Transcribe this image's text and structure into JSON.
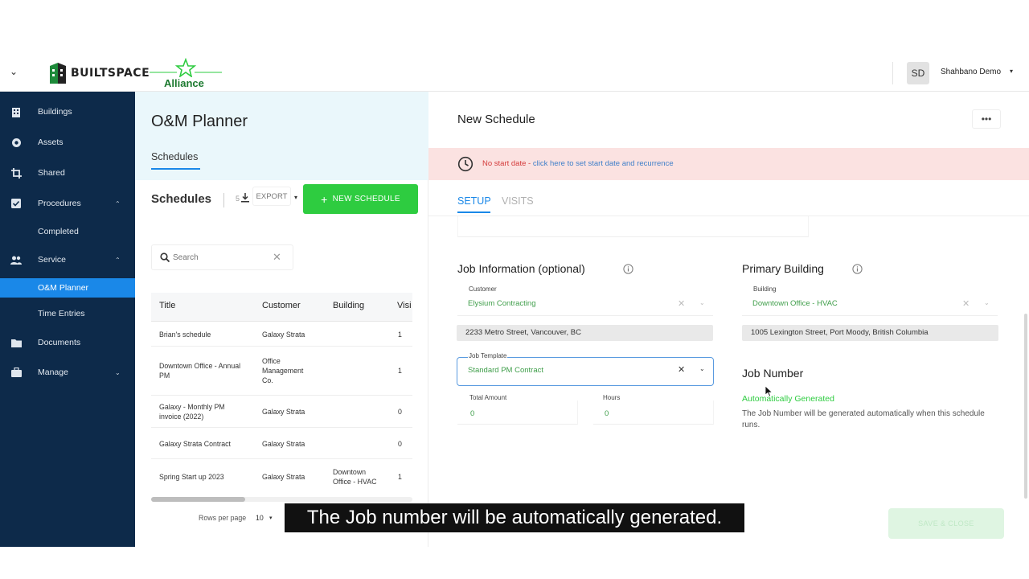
{
  "header": {
    "brand_name": "BUILTSPACE",
    "partner_name": "Alliance",
    "user_initials": "SD",
    "user_name": "Shahbano Demo",
    "user_caret": "▾",
    "menu_chevron": "⌄"
  },
  "sidebar": {
    "items": [
      {
        "label": "Buildings",
        "icon": "building-icon"
      },
      {
        "label": "Assets",
        "icon": "asset-icon"
      },
      {
        "label": "Shared",
        "icon": "crop-icon"
      },
      {
        "label": "Procedures",
        "icon": "checkbox-icon",
        "chevron": "⌃"
      },
      {
        "label": "Completed"
      },
      {
        "label": "Service",
        "icon": "users-icon",
        "chevron": "⌃"
      },
      {
        "label": "O&M Planner",
        "active": true
      },
      {
        "label": "Time Entries"
      },
      {
        "label": "Documents",
        "icon": "folder-icon"
      },
      {
        "label": "Manage",
        "icon": "briefcase-icon",
        "chevron": "⌄"
      }
    ],
    "active_color": "#1a88e8",
    "bg_color": "#0d2a4a"
  },
  "left_panel": {
    "title": "O&M Planner",
    "tab": "Schedules",
    "list_title": "Schedules",
    "count": "5",
    "export_label": "EXPORT",
    "export_caret": "▾",
    "new_schedule_label": "NEW SCHEDULE",
    "new_schedule_plus": "+",
    "search_placeholder": "Search",
    "search_clear": "✕",
    "columns": [
      "Title",
      "Customer",
      "Building",
      "Visi"
    ],
    "rows": [
      {
        "title": "Brian's schedule",
        "customer": "Galaxy Strata",
        "building": "",
        "visits": "1"
      },
      {
        "title": "Downtown Office - Annual PM",
        "customer": "Office Management Co.",
        "building": "",
        "visits": "1"
      },
      {
        "title": "Galaxy - Monthly PM invoice (2022)",
        "customer": "Galaxy Strata",
        "building": "",
        "visits": "0"
      },
      {
        "title": "Galaxy Strata Contract",
        "customer": "Galaxy Strata",
        "building": "",
        "visits": "0"
      },
      {
        "title": "Spring Start up 2023",
        "customer": "Galaxy Strata",
        "building": "Downtown Office - HVAC",
        "visits": "1"
      }
    ],
    "rows_per_page_label": "Rows per page",
    "rows_per_page_value": "10",
    "rows_per_page_caret": "▾"
  },
  "right_panel": {
    "title": "New Schedule",
    "more_label": "•••",
    "alert_red": "No start date",
    "alert_sep": " - ",
    "alert_link": "click here to set start date and recurrence",
    "tab_setup": "SETUP",
    "tab_visits": "VISITS",
    "job_info_title": "Job Information (optional)",
    "customer_label": "Customer",
    "customer_value": "Elysium Contracting",
    "customer_address": "2233 Metro Street, Vancouver, BC",
    "job_template_label": "Job Template",
    "job_template_value": "Standard PM Contract",
    "total_amount_label": "Total Amount",
    "total_amount_value": "0",
    "hours_label": "Hours",
    "hours_value": "0",
    "primary_building_title": "Primary Building",
    "building_label": "Building",
    "building_value": "Downtown Office - HVAC",
    "building_address": "1005 Lexington Street, Port Moody, British Columbia",
    "job_number_title": "Job Number",
    "auto_generated": "Automatically Generated",
    "auto_desc": "The Job Number will be generated automatically when this schedule runs.",
    "save_label": "SAVE & CLOSE",
    "clear_x": "✕",
    "chevron": "⌄"
  },
  "caption": "The Job number will be automatically generated.",
  "colors": {
    "green": "#2ecc40",
    "blue": "#1a88e8",
    "alert_bg": "#fbe2e1"
  }
}
